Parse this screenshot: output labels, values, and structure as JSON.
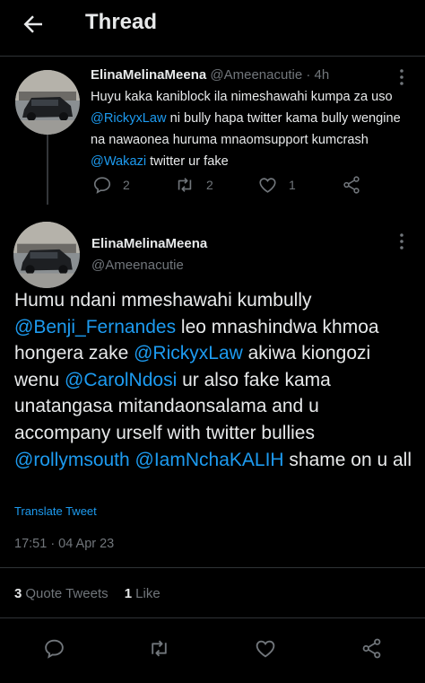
{
  "header": {
    "title": "Thread",
    "back_icon": "arrow-left-icon"
  },
  "reply_tweet": {
    "display_name": "ElinaMelinaMeena",
    "handle": "@Ameenacutie",
    "separator": "·",
    "age": "4h",
    "text": [
      {
        "t": "Huyu kaka kaniblock ila nimeshawahi kumpa za uso "
      },
      {
        "t": "@RickyxLaw",
        "link": true
      },
      {
        "t": "  ni bully hapa twitter kama bully wengine na nawaonea huruma mnaomsupport kumcrash "
      },
      {
        "t": "@Wakazi",
        "link": true
      },
      {
        "t": "  twitter ur fake"
      }
    ],
    "replies": "2",
    "retweets": "2",
    "likes": "1"
  },
  "main_tweet": {
    "display_name": "ElinaMelinaMeena",
    "handle": "@Ameenacutie",
    "text": [
      {
        "t": "Humu ndani mmeshawahi kumbully "
      },
      {
        "t": "@Benji_Fernandes",
        "link": true
      },
      {
        "t": "  leo mnashindwa khmoa hongera zake "
      },
      {
        "t": "@RickyxLaw",
        "link": true
      },
      {
        "t": " akiwa kiongozi wenu "
      },
      {
        "t": "@CarolNdosi",
        "link": true
      },
      {
        "t": " ur also fake kama unatangasa mitandaonsalama and u accompany urself with twitter bullies "
      },
      {
        "t": "@rollymsouth",
        "link": true
      },
      {
        "t": " "
      },
      {
        "t": "@IamNchaKALIH",
        "link": true
      },
      {
        "t": "  shame on u all"
      }
    ],
    "translate_label": "Translate Tweet",
    "timestamp": "17:51 · 04 Apr 23",
    "quote_tweets_count": "3",
    "quote_tweets_label": "Quote Tweets",
    "likes_count": "1",
    "likes_label": "Like"
  },
  "colors": {
    "background": "#000000",
    "text": "#e7e9ea",
    "muted": "#71767b",
    "link": "#1d9bf0",
    "divider": "#2f3336"
  }
}
